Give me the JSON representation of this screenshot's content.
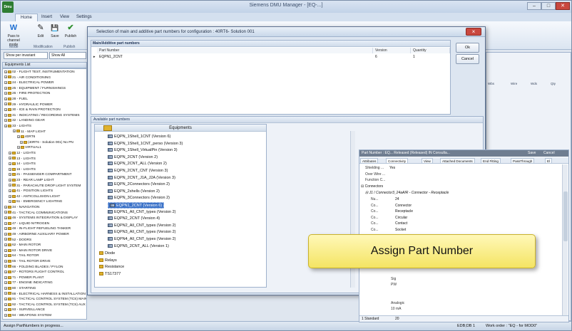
{
  "app": {
    "title": "Siemens DMU Manager - [EQ-...]",
    "logo_text": "Dmu",
    "window_buttons": {
      "minimize": "–",
      "maximize": "□",
      "close": "✕"
    }
  },
  "ribbon": {
    "tabs": [
      "Home",
      "Insert",
      "View",
      "Settings"
    ],
    "buttons": [
      {
        "label": "Pass to channel mode",
        "icon": "W"
      },
      {
        "label": "Edit",
        "icon": "✎"
      },
      {
        "label": "Save",
        "icon": "💾"
      },
      {
        "label": "Publish",
        "icon": "✔"
      }
    ],
    "groups": [
      "Mode",
      "Modification",
      "Publish"
    ]
  },
  "left_panel": {
    "filter1": "Show per invariant",
    "filter2": "Show All",
    "header": "Equipments List",
    "items": [
      "02 - FLIGHT TEST, INSTRUMENTATION",
      "21 - AIR CONDITIONING",
      "24 - ELECTRICAL POWER",
      "25 - EQUIPMENT / FURNISHINGS",
      "26 - FIRE PROTECTION",
      "28 - FUEL",
      "29 - HYDRAULIC POWER",
      "30 - ICE & RAIN PROTECTION",
      "31 - INDICATING / RECORDING SYSTEMS",
      "32 - LANDING GEAR",
      "33 - LIGHTS",
      "11 - MAP LIGHT",
      "40RT6",
      "(40RT6 - Solution 001) No PN",
      "VIRTUAL1",
      "12 - LIGHTS",
      "13 - LIGHTS",
      "14 - LIGHTS",
      "16 - LIGHTS",
      "21 - PASSENGER COMPARTMENT",
      "23 - REAR LAMP LIGHT",
      "31 - PARACHUTE DROP LIGHT SYSTEM",
      "41 - POSITION LIGHTS",
      "42 - ANTICOLLISION LIGHT",
      "51 - EMERGENCY LIGHTING",
      "34 - NAVIGATION",
      "41 - TACTICAL COMMUNICATIONS",
      "46 - SYSTEMS INTEGRATION & DISPLAY",
      "47 - LIQUID NITROGEN",
      "48 - IN-FLIGHT REFUELING TANKER",
      "49 - AIRBORNE AUXILIARY POWER",
      "52 - DOORS",
      "62 - MAIN ROTOR",
      "63 - MAIN ROTOR DRIVE",
      "64 - TAIL ROTOR",
      "65 - TAIL ROTOR DRIVE",
      "66 - FOLDING BLADES / PYLON",
      "67 - ROTORS FLIGHT CONTROL",
      "71 - POWER PLANT",
      "77 - ENGINE INDICATING",
      "80 - STARTING",
      "88 - ELECTRICAL HARNESS & INSTALLATION",
      "91 - TACTICAL CONTROL SYSTEM (TCS) MAIN",
      "92 - TACTICAL CONTROL SYSTEM (TCS) AUX",
      "93 - SURVEILLANCE",
      "94 - WEAPONS SYSTEM"
    ]
  },
  "right_panel": {
    "tabs": [
      "Wbs",
      "Wire",
      "Wds",
      "Qty"
    ]
  },
  "dialog": {
    "title": "Selection of main and additive part numbers for configuration : 40RT6- Solution 001",
    "main_section": {
      "header": "Main/Additive part numbers",
      "columns": [
        "Part Number",
        "Version",
        "Quantity"
      ],
      "rows": [
        {
          "part_number": "EQPN1_2CNT",
          "version": "6",
          "quantity": "1"
        }
      ]
    },
    "ok_label": "Ok",
    "cancel_label": "Cancel",
    "available_header": "Available part numbers",
    "equipments_header": "Equipments",
    "part_numbers": [
      "EQPN_1Shell_1CNT (Version 6)",
      "EQPN_1Shell_1CNT_perso (Version 3)",
      "EQPN_1Shell_VirtualPin (Version 3)",
      "EQPN_2CNT (Version 2)",
      "EQPN_2CNT_ALL (Version 2)",
      "EQPN_2CNT_CNT (Version 3)",
      "EQPN_2CNT_J1A_J2A (Version 3)",
      "EQPN_2Connectors (Version 2)",
      "EQPN_2shells (Version 2)",
      "EQPN_3Connectors (Version 2)",
      "EQPN1_2CNT (Version 6)",
      "EQPN1_All_CNT_types (Version 2)",
      "EQPN2_2CNT (Version 4)",
      "EQPN2_All_CNT_types (Version 2)",
      "EQPN3_All_CNT_types (Version 2)",
      "EQPN4_All_CNT_types (Version 2)",
      "EQPN5_2CNT_ALL (Version 1)"
    ],
    "selected_index": 10,
    "folders": [
      "Diode",
      "Relays",
      "Resistance",
      "TS17377"
    ],
    "detail": {
      "pn_bar": "Part Number : EQ...   Released (Released)   IN   Consulta...",
      "save_label": "Save",
      "cancel_label": "Cancel",
      "tabs": [
        "Attributes",
        "Connectivity",
        "View",
        "Attached Documents",
        "End Fitting",
        "PassThrough",
        "El"
      ],
      "active_tab": 1,
      "top_rows": [
        {
          "label": "Shielding ...",
          "value": "Yes"
        },
        {
          "label": "Over Wire ...",
          "value": ""
        },
        {
          "label": "Function C...",
          "value": ""
        }
      ],
      "group": "Connectors",
      "connector": "J1 /   Connector3_24aAIR - Connector - Receptacle",
      "conn_rows": [
        {
          "label": "Nu...",
          "value": "24"
        },
        {
          "label": "Co...",
          "value": "Connector"
        },
        {
          "label": "Co...",
          "value": "Receptacle"
        },
        {
          "label": "Co...",
          "value": "Circular"
        },
        {
          "label": "Co...",
          "value": "Contact"
        },
        {
          "label": "Co...",
          "value": "Socket"
        },
        {
          "label": "Co...",
          "value": "EN3645_25N24 Version 1"
        },
        {
          "label": "Shi...",
          "value": "Yes"
        },
        {
          "label": "Ca...",
          "value": ""
        },
        {
          "label": "Key...",
          "value": ""
        },
        {
          "label": "Fun...",
          "value": ""
        }
      ],
      "contacts_label": "Contact",
      "sub_rows": [
        {
          "label": "Sig",
          "value": ""
        },
        {
          "label": "PW",
          "value": ""
        },
        {
          "label": "Analogic",
          "value": ""
        },
        {
          "label": "10 mA",
          "value": ""
        }
      ],
      "foot_left": "1   Standard",
      "foot_right": "20"
    }
  },
  "callout": {
    "text": "Assign Part Number"
  },
  "statusbar": {
    "left": "Assign PartNumbers in progress...",
    "db": "EDB;DB 1",
    "work_order": "Work order : \"EQ - for MOD0\""
  },
  "colors": {
    "accent": "#3b72c8",
    "callout": "#f4e463",
    "close": "#c9483f"
  }
}
